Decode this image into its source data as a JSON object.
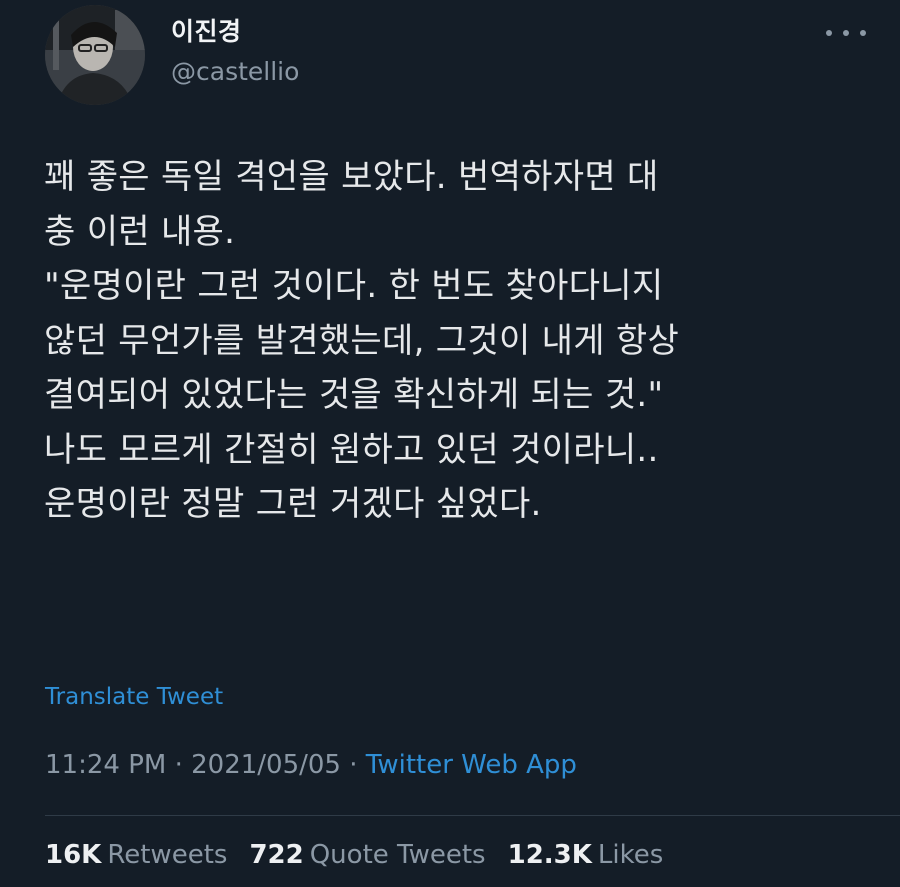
{
  "author": {
    "display_name": "이진경",
    "handle": "@castellio"
  },
  "tweet": {
    "lines": [
      "꽤 좋은 독일 격언을 보았다. 번역하자면 대",
      "충 이런 내용.",
      "\"운명이란 그런 것이다. 한 번도 찾아다니지",
      "않던 무언가를 발견했는데, 그것이 내게 항상",
      "결여되어 있었다는 것을 확신하게 되는 것.\"",
      "나도 모르게 간절히 원하고 있던 것이라니..",
      "운명이란 정말 그런 거겠다 싶었다."
    ],
    "translate_label": "Translate Tweet"
  },
  "meta": {
    "time": "11:24 PM",
    "separator1": " · ",
    "date": "2021/05/05",
    "separator2": " · ",
    "source": "Twitter Web App"
  },
  "stats": {
    "retweets_count": "16K",
    "retweets_label": "Retweets",
    "quotes_count": "722",
    "quotes_label": "Quote Tweets",
    "likes_count": "12.3K",
    "likes_label": "Likes"
  },
  "icons": {
    "more": "more-horizontal-icon",
    "avatar": "profile-photo"
  },
  "colors": {
    "background": "#141d27",
    "link": "#2f8fd6",
    "secondary_text": "#8b98a5",
    "primary_text": "#e6e8ea"
  }
}
